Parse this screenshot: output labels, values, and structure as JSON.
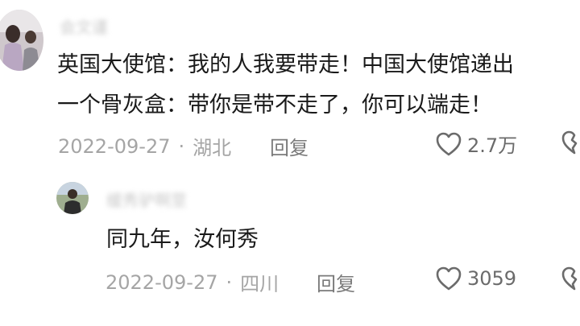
{
  "comment": {
    "username": "会文谨",
    "lines": [
      "英国大使馆：我的人我要带走！中国大使馆递出",
      "一个骨灰盒：带你是带不走了，你可以端走！"
    ],
    "date": "2022-09-27",
    "location": "湖北",
    "reply_label": "回复",
    "like_count": "2.7万"
  },
  "reply_comment": {
    "username": "缓秀驴啊莖",
    "text": "同九年，汝何秀",
    "date": "2022-09-27",
    "location": "四川",
    "reply_label": "回复",
    "like_count": "3059"
  },
  "separator": "·",
  "icons": {
    "like": "heart-icon",
    "dislike": "broken-heart-icon"
  },
  "colors": {
    "text": "#1a1a1a",
    "meta": "#a5a5a5",
    "icon": "#6b6b6b"
  }
}
